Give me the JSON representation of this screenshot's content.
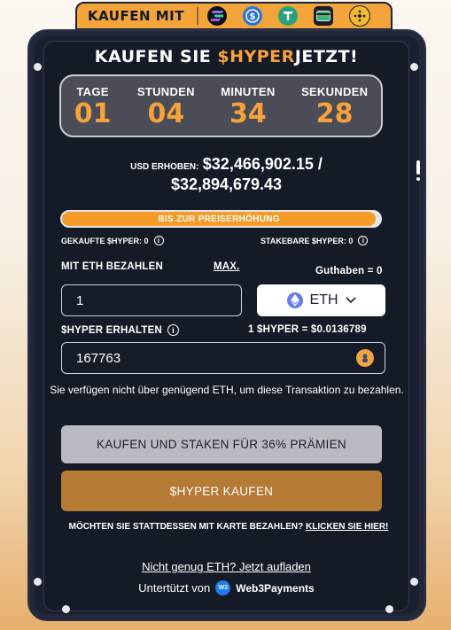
{
  "payment_strip": {
    "label": "KAUFEN MIT",
    "icons": [
      "solana-icon",
      "usdc-icon",
      "tether-icon",
      "card-icon",
      "bnb-icon"
    ]
  },
  "title": {
    "prefix": "KAUFEN SIE ",
    "highlight": "$HYPER",
    "suffix": "JETZT!"
  },
  "countdown": [
    {
      "label": "TAGE",
      "value": "01"
    },
    {
      "label": "STUNDEN",
      "value": "04"
    },
    {
      "label": "MINUTEN",
      "value": "34"
    },
    {
      "label": "SEKUNDEN",
      "value": "28"
    }
  ],
  "raised": {
    "label": "USD ERHOBEN:",
    "amount": "$32,466,902.15 /",
    "target": "$32,894,679.43"
  },
  "progress": {
    "label": "BIS ZUR PREISERHÖHUNG",
    "fraction": 0.987
  },
  "stats": {
    "bought": "GEKAUFTE $HYPER: 0",
    "stakeable": "STAKEBARE $HYPER: 0"
  },
  "pay": {
    "label": "MIT ETH BEZAHLEN",
    "max_label": "MAX.",
    "balance": "Guthaben = 0",
    "amount": "1",
    "currency": "ETH"
  },
  "receive": {
    "label": "$HYPER ERHALTEN",
    "rate": "1 $HYPER = $0.0136789",
    "amount": "167763"
  },
  "notice": "Sie verfügen nicht über genügend ETH, um diese Transaktion zu bezahlen.",
  "buttons": {
    "stake": "KAUFEN UND STAKEN FÜR 36% PRÄMIEN",
    "buy": "$HYPER KAUFEN"
  },
  "card": {
    "text": "MÖCHTEN SIE STATTDESSEN MIT KARTE BEZAHLEN? ",
    "link": "KLICKEN SIE HIER!"
  },
  "topup": "Nicht genug ETH? Jetzt aufladen",
  "powered": {
    "label": "Untertützt von",
    "brand": "Web3Payments"
  },
  "colors": {
    "accent": "#f7a23a",
    "panel": "#1b2030",
    "buy_button": "#b57a33"
  }
}
